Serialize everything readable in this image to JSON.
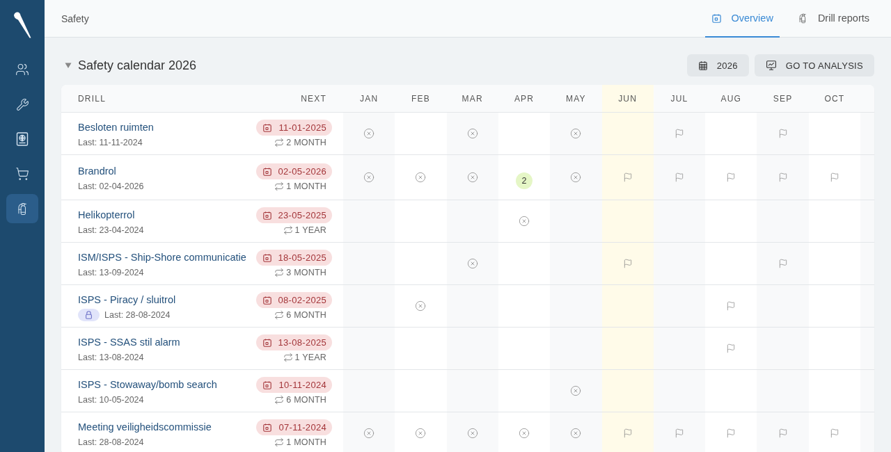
{
  "sidebar": {
    "items": [
      {
        "selected": false
      },
      {
        "selected": false
      },
      {
        "selected": false
      },
      {
        "selected": false
      },
      {
        "selected": true
      }
    ]
  },
  "header": {
    "title": "Safety",
    "tabs": [
      {
        "label": "Overview",
        "selected": true
      },
      {
        "label": "Drill reports",
        "selected": false
      }
    ]
  },
  "section": {
    "title": "Safety calendar 2026",
    "expanded": true,
    "buttons": [
      {
        "label": "2026"
      },
      {
        "label": "GO TO ANALYSIS"
      }
    ]
  },
  "table": {
    "columns": {
      "drill": "DRILL",
      "next": "NEXT"
    },
    "months": [
      {
        "label": "JAN",
        "current": false
      },
      {
        "label": "FEB",
        "current": false
      },
      {
        "label": "MAR",
        "current": false
      },
      {
        "label": "APR",
        "current": false
      },
      {
        "label": "MAY",
        "current": false
      },
      {
        "label": "JUN",
        "current": true
      },
      {
        "label": "JUL",
        "current": false
      },
      {
        "label": "AUG",
        "current": false
      },
      {
        "label": "SEP",
        "current": false
      },
      {
        "label": "OCT",
        "current": false
      }
    ],
    "rows": [
      {
        "name": "Besloten ruimten",
        "locked": false,
        "last": "Last: 11-11-2024",
        "next": "11-01-2025",
        "frequency": "2 MONTH",
        "cells": [
          {
            "kind": "missed"
          },
          {
            "kind": "none"
          },
          {
            "kind": "missed"
          },
          {
            "kind": "none"
          },
          {
            "kind": "missed"
          },
          {
            "kind": "none"
          },
          {
            "kind": "planned"
          },
          {
            "kind": "none"
          },
          {
            "kind": "planned"
          },
          {
            "kind": "none"
          }
        ]
      },
      {
        "name": "Brandrol",
        "locked": false,
        "last": "Last: 02-04-2026",
        "next": "02-05-2026",
        "frequency": "1 MONTH",
        "cells": [
          {
            "kind": "missed"
          },
          {
            "kind": "missed"
          },
          {
            "kind": "missed"
          },
          {
            "kind": "count",
            "text": "2"
          },
          {
            "kind": "missed"
          },
          {
            "kind": "planned"
          },
          {
            "kind": "planned"
          },
          {
            "kind": "planned"
          },
          {
            "kind": "planned"
          },
          {
            "kind": "planned"
          }
        ]
      },
      {
        "name": "Helikopterrol",
        "locked": false,
        "last": "Last: 23-04-2024",
        "next": "23-05-2025",
        "frequency": "1 YEAR",
        "cells": [
          {
            "kind": "none"
          },
          {
            "kind": "none"
          },
          {
            "kind": "none"
          },
          {
            "kind": "missed"
          },
          {
            "kind": "none"
          },
          {
            "kind": "none"
          },
          {
            "kind": "none"
          },
          {
            "kind": "none"
          },
          {
            "kind": "none"
          },
          {
            "kind": "none"
          }
        ]
      },
      {
        "name": "ISM/ISPS - Ship-Shore communicatie",
        "locked": false,
        "last": "Last: 13-09-2024",
        "next": "18-05-2025",
        "frequency": "3 MONTH",
        "cells": [
          {
            "kind": "none"
          },
          {
            "kind": "none"
          },
          {
            "kind": "missed"
          },
          {
            "kind": "none"
          },
          {
            "kind": "none"
          },
          {
            "kind": "planned"
          },
          {
            "kind": "none"
          },
          {
            "kind": "none"
          },
          {
            "kind": "planned"
          },
          {
            "kind": "none"
          }
        ]
      },
      {
        "name": "ISPS - Piracy / sluitrol",
        "locked": true,
        "last": "Last: 28-08-2024",
        "next": "08-02-2025",
        "frequency": "6 MONTH",
        "cells": [
          {
            "kind": "none"
          },
          {
            "kind": "missed"
          },
          {
            "kind": "none"
          },
          {
            "kind": "none"
          },
          {
            "kind": "none"
          },
          {
            "kind": "none"
          },
          {
            "kind": "none"
          },
          {
            "kind": "planned"
          },
          {
            "kind": "none"
          },
          {
            "kind": "none"
          }
        ]
      },
      {
        "name": "ISPS - SSAS stil alarm",
        "locked": false,
        "last": "Last: 13-08-2024",
        "next": "13-08-2025",
        "frequency": "1 YEAR",
        "cells": [
          {
            "kind": "none"
          },
          {
            "kind": "none"
          },
          {
            "kind": "none"
          },
          {
            "kind": "none"
          },
          {
            "kind": "none"
          },
          {
            "kind": "none"
          },
          {
            "kind": "none"
          },
          {
            "kind": "planned"
          },
          {
            "kind": "none"
          },
          {
            "kind": "none"
          }
        ]
      },
      {
        "name": "ISPS - Stowaway/bomb search",
        "locked": false,
        "last": "Last: 10-05-2024",
        "next": "10-11-2024",
        "frequency": "6 MONTH",
        "cells": [
          {
            "kind": "none"
          },
          {
            "kind": "none"
          },
          {
            "kind": "none"
          },
          {
            "kind": "none"
          },
          {
            "kind": "missed"
          },
          {
            "kind": "none"
          },
          {
            "kind": "none"
          },
          {
            "kind": "none"
          },
          {
            "kind": "none"
          },
          {
            "kind": "none"
          }
        ]
      },
      {
        "name": "Meeting veiligheidscommissie",
        "locked": false,
        "last": "Last: 28-08-2024",
        "next": "07-11-2024",
        "frequency": "1 MONTH",
        "cells": [
          {
            "kind": "missed"
          },
          {
            "kind": "missed"
          },
          {
            "kind": "missed"
          },
          {
            "kind": "missed"
          },
          {
            "kind": "missed"
          },
          {
            "kind": "planned"
          },
          {
            "kind": "planned"
          },
          {
            "kind": "planned"
          },
          {
            "kind": "planned"
          },
          {
            "kind": "planned"
          }
        ]
      }
    ]
  }
}
